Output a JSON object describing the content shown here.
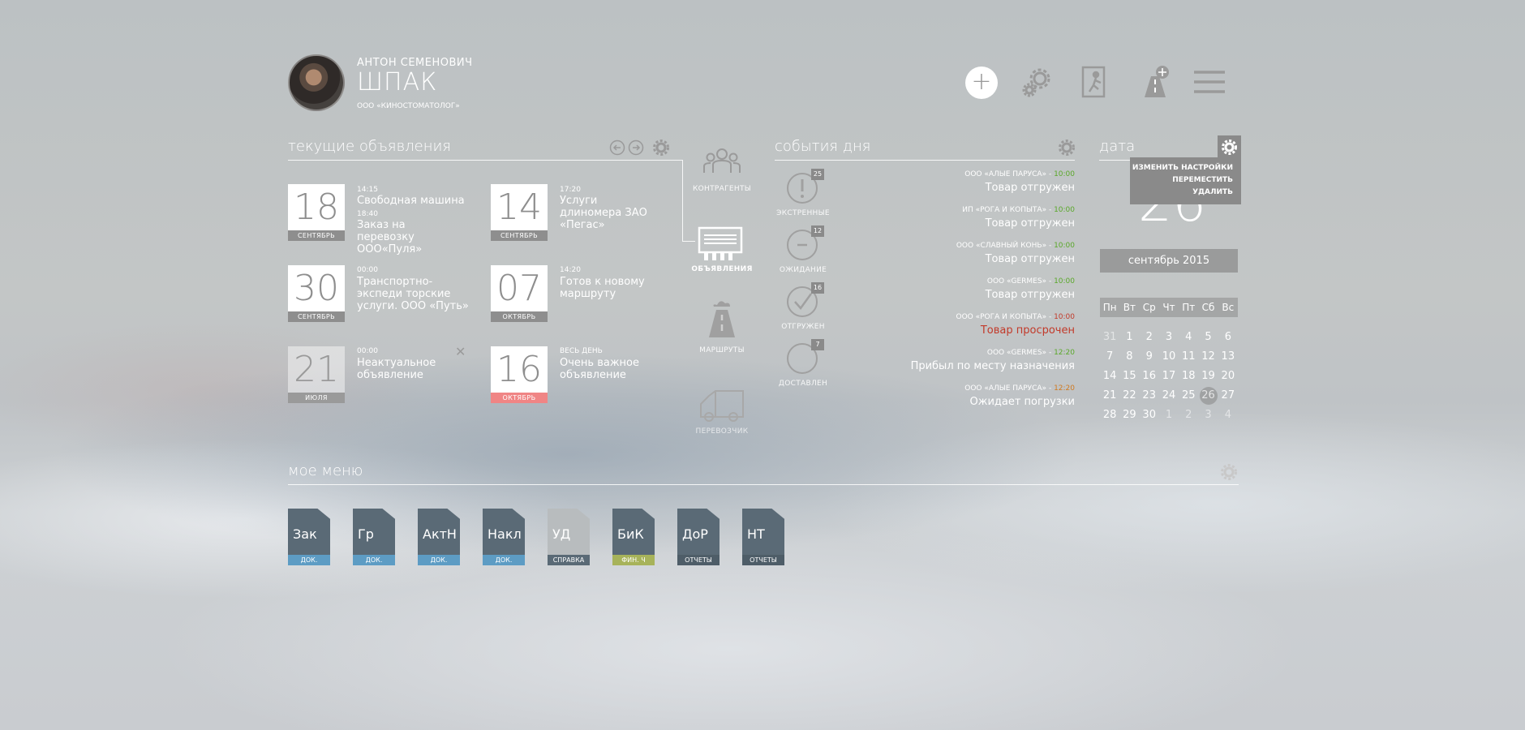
{
  "header": {
    "user_first": "АНТОН СЕМЕНОВИЧ",
    "user_last": "ШПАК",
    "user_org": "ООО «КИНОСТОМАТОЛОГ»",
    "add_symbol": "+"
  },
  "announcements": {
    "title": "текущие объявления",
    "items": [
      {
        "day": "18",
        "month": "СЕНТЯБРЬ",
        "lines": [
          {
            "time": "14:15",
            "text": "Свободная машина"
          },
          {
            "time": "18:40",
            "text": "Заказ на перевозку ООО«Пуля»"
          }
        ]
      },
      {
        "day": "14",
        "month": "СЕНТЯБРЬ",
        "lines": [
          {
            "time": "17:20",
            "text": "Услуги длиномера ЗАО «Пегас»"
          }
        ]
      },
      {
        "day": "30",
        "month": "СЕНТЯБРЬ",
        "lines": [
          {
            "time": "00:00",
            "text": "Транспортно-экспеди торские услуги. ООО «Путь»"
          }
        ]
      },
      {
        "day": "07",
        "month": "ОКТЯБРЬ",
        "lines": [
          {
            "time": "14:20",
            "text": "Готов к новому маршруту"
          }
        ]
      },
      {
        "day": "21",
        "month": "ИЮЛЯ",
        "lines": [
          {
            "time": "00:00",
            "text": "Неактуальное объявление"
          }
        ]
      },
      {
        "day": "16",
        "month": "ОКТЯБРЬ",
        "lines": [
          {
            "time": "ВЕСЬ ДЕНЬ",
            "text": "Очень важное объявление"
          }
        ]
      }
    ],
    "close_symbol": "✕"
  },
  "nav": {
    "contractors": "КОНТРАГЕНТЫ",
    "announcements": "ОБЪЯВЛЕНИЯ",
    "routes": "МАРШРУТЫ",
    "carrier": "ПЕРЕВОЗЧИК"
  },
  "events": {
    "title": "события дня",
    "statuses": [
      {
        "label": "ЭКСТРЕННЫЕ",
        "count": "25",
        "glyph": "!"
      },
      {
        "label": "ОЖИДАНИЕ",
        "count": "12",
        "glyph": "–"
      },
      {
        "label": "ОТГРУЖЕН",
        "count": "16",
        "glyph": "✓"
      },
      {
        "label": "ДОСТАВЛЕН",
        "count": "7",
        "glyph": ""
      }
    ],
    "items": [
      {
        "src": "ООО «АЛЫЕ ПАРУСА»",
        "time": "10:00",
        "tc": "tm-g",
        "status": "Товар отгружен",
        "red": false
      },
      {
        "src": "ИП «РОГА И КОПЫТА»",
        "time": "10:00",
        "tc": "tm-g",
        "status": "Товар отгружен",
        "red": false
      },
      {
        "src": "ООО «СЛАВНЫЙ КОНЬ»",
        "time": "10:00",
        "tc": "tm-g",
        "status": "Товар отгружен",
        "red": false
      },
      {
        "src": "ООО «GERMES»",
        "time": "10:00",
        "tc": "tm-g",
        "status": "Товар отгружен",
        "red": false
      },
      {
        "src": "ООО «РОГА И КОПЫТА»",
        "time": "10:00",
        "tc": "tm-r",
        "status": "Товар просрочен",
        "red": true
      },
      {
        "src": "ООО «GERMES»",
        "time": "12:20",
        "tc": "tm-g",
        "status": "Прибыл по месту назначения",
        "red": false
      },
      {
        "src": "ООО «АЛЫЕ ПАРУСА»",
        "time": "12:20",
        "tc": "tm-o",
        "status": "Ожидает погрузки",
        "red": false
      }
    ]
  },
  "date_widget": {
    "title": "дата",
    "big_day": "26",
    "menu": [
      "ИЗМЕНИТЬ НАСТРОЙКИ",
      "ПЕРЕМЕСТИТЬ",
      "УДАЛИТЬ"
    ],
    "month": "сентябрь 2015",
    "weekdays": [
      "Пн",
      "Вт",
      "Ср",
      "Чт",
      "Пт",
      "Сб",
      "Вс"
    ],
    "weeks": [
      [
        "31",
        "1",
        "2",
        "3",
        "4",
        "5",
        "6"
      ],
      [
        "7",
        "8",
        "9",
        "10",
        "11",
        "12",
        "13"
      ],
      [
        "14",
        "15",
        "16",
        "17",
        "18",
        "19",
        "20"
      ],
      [
        "21",
        "22",
        "23",
        "24",
        "25",
        "26",
        "27"
      ],
      [
        "28",
        "29",
        "30",
        "1",
        "2",
        "3",
        "4"
      ]
    ],
    "today": "26"
  },
  "my_menu": {
    "title": "мое меню",
    "items": [
      {
        "abbr": "Зак",
        "tag": "ДОК.",
        "body_color": "#5a6a76",
        "tag_color": "#5d9cc4"
      },
      {
        "abbr": "Гр",
        "tag": "ДОК.",
        "body_color": "#5a6a76",
        "tag_color": "#5d9cc4"
      },
      {
        "abbr": "АктН",
        "tag": "ДОК.",
        "body_color": "#5a6a76",
        "tag_color": "#5d9cc4"
      },
      {
        "abbr": "Накл",
        "tag": "ДОК.",
        "body_color": "#5a6a76",
        "tag_color": "#5d9cc4"
      },
      {
        "abbr": "УД",
        "tag": "СПРАВКА",
        "body_color": "#b8bcbe",
        "tag_color": "#5a6a76"
      },
      {
        "abbr": "БиК",
        "tag": "ФИН. Ч",
        "body_color": "#5a6a76",
        "tag_color": "#a7b35a"
      },
      {
        "abbr": "ДоР",
        "tag": "ОТЧЕТЫ",
        "body_color": "#5a6a76",
        "tag_color": "#4e5d68"
      },
      {
        "abbr": "НТ",
        "tag": "ОТЧЕТЫ",
        "body_color": "#5a6a76",
        "tag_color": "#4e5d68"
      }
    ]
  },
  "colors": {
    "accent_red": "#f08585",
    "time_green": "#5aa82a",
    "time_red": "#c23a2a",
    "time_orange": "#d07a20"
  }
}
